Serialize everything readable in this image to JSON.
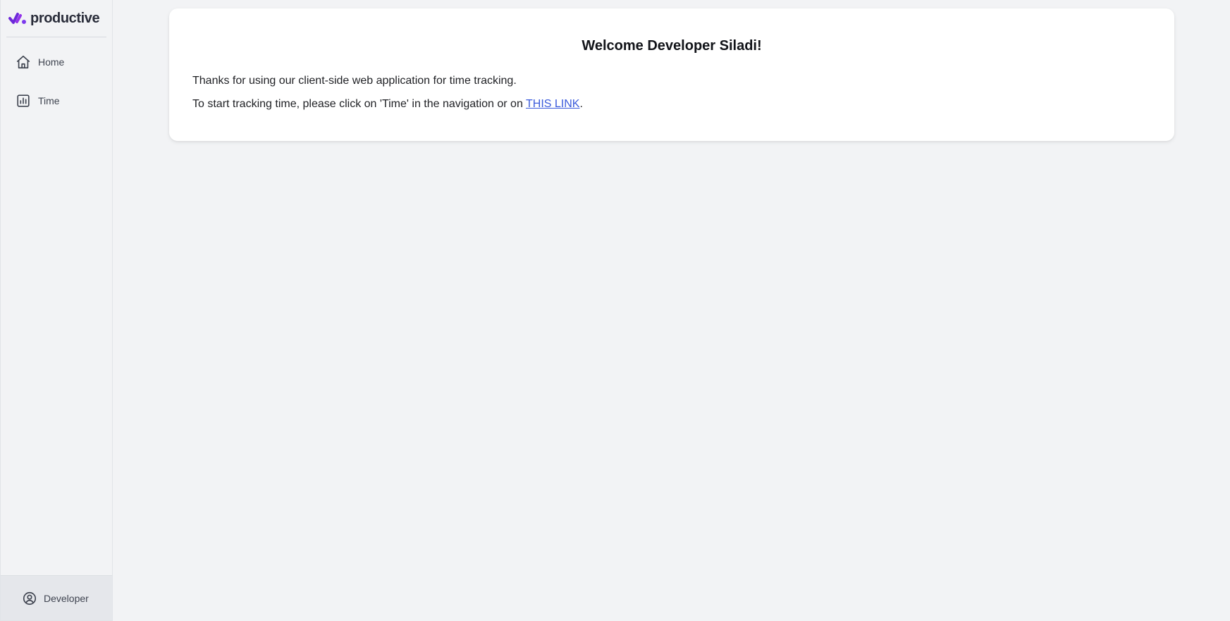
{
  "brand": {
    "name": "productive",
    "logo_icon": "checkmark-logo-icon"
  },
  "nav": {
    "items": [
      {
        "label": "Home",
        "icon": "home-icon"
      },
      {
        "label": "Time",
        "icon": "bar-chart-icon"
      }
    ]
  },
  "user": {
    "label": "Developer",
    "icon": "user-circle-icon"
  },
  "welcome": {
    "title": "Welcome Developer Siladi!",
    "line1": "Thanks for using our client-side web application for time tracking.",
    "line2_prefix": "To start tracking time, please click on 'Time' in the navigation or on ",
    "link_text": "THIS LINK",
    "line2_suffix": "."
  },
  "colors": {
    "background": "#f2f3f5",
    "card": "#ffffff",
    "link": "#3b5bdb",
    "logo_primary": "#6d28d9",
    "logo_secondary": "#9333ea"
  }
}
